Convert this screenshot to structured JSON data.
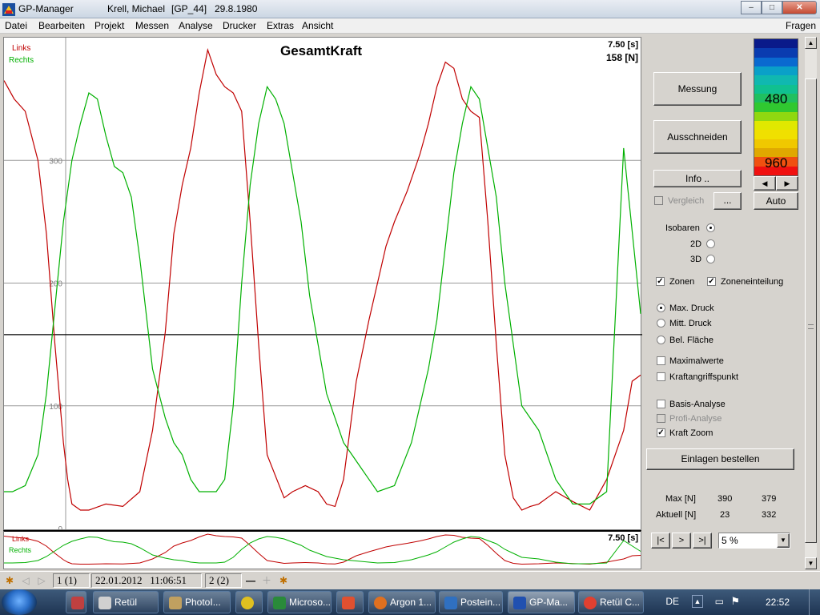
{
  "window": {
    "app_name": "GP-Manager",
    "patient_name": "Krell, Michael",
    "patient_code": "[GP_44]",
    "birth_date": "29.8.1980",
    "buttons": {
      "minimize": "–",
      "maximize": "□",
      "close": "✕"
    }
  },
  "menu": {
    "items": [
      "Datei",
      "Bearbeiten",
      "Projekt",
      "Messen",
      "Analyse",
      "Drucker",
      "Extras",
      "Ansicht"
    ],
    "help": "Fragen"
  },
  "chart": {
    "title": "GesamtKraft",
    "time_readout": "7.50 [s]",
    "force_readout": "158 [N]",
    "legend_links": "Links",
    "legend_rechts": "Rechts",
    "mini_time_readout": "7.50 [s]"
  },
  "chart_data": {
    "type": "line",
    "title": "GesamtKraft",
    "ylim": [
      0,
      400
    ],
    "yticks": [
      "300",
      "200",
      "100",
      "0"
    ],
    "cursor_value": 158,
    "xlim": [
      0,
      7.5
    ],
    "series": [
      {
        "name": "Links",
        "color": "#c00000",
        "x": [
          0,
          0.12,
          0.25,
          0.4,
          0.5,
          0.6,
          0.7,
          0.75,
          0.8,
          0.9,
          1.0,
          1.2,
          1.4,
          1.6,
          1.75,
          1.9,
          2.0,
          2.1,
          2.2,
          2.3,
          2.4,
          2.5,
          2.6,
          2.7,
          2.8,
          2.9,
          3.0,
          3.1,
          3.3,
          3.4,
          3.55,
          3.7,
          3.8,
          3.9,
          4.0,
          4.15,
          4.3,
          4.5,
          4.6,
          4.75,
          4.9,
          5.0,
          5.1,
          5.2,
          5.3,
          5.4,
          5.5,
          5.6,
          5.7,
          5.8,
          5.9,
          6.0,
          6.1,
          6.2,
          6.3,
          6.4,
          6.5,
          6.7,
          6.9,
          7.1,
          7.3,
          7.4,
          7.5
        ],
        "y": [
          365,
          350,
          340,
          300,
          240,
          150,
          70,
          40,
          20,
          15,
          15,
          20,
          18,
          30,
          80,
          160,
          240,
          280,
          310,
          355,
          390,
          370,
          360,
          355,
          340,
          250,
          150,
          60,
          25,
          30,
          35,
          30,
          20,
          18,
          40,
          120,
          170,
          230,
          250,
          275,
          305,
          330,
          360,
          380,
          375,
          350,
          340,
          335,
          250,
          150,
          60,
          25,
          15,
          18,
          20,
          25,
          30,
          22,
          15,
          40,
          80,
          120,
          125
        ]
      },
      {
        "name": "Rechts",
        "color": "#00b000",
        "x": [
          0,
          0.1,
          0.25,
          0.4,
          0.5,
          0.6,
          0.7,
          0.8,
          0.9,
          1.0,
          1.1,
          1.2,
          1.3,
          1.4,
          1.5,
          1.6,
          1.75,
          1.9,
          2.0,
          2.1,
          2.2,
          2.3,
          2.4,
          2.5,
          2.6,
          2.7,
          2.8,
          2.9,
          3.0,
          3.1,
          3.2,
          3.3,
          3.4,
          3.5,
          3.6,
          3.7,
          3.8,
          3.9,
          4.0,
          4.1,
          4.2,
          4.3,
          4.4,
          4.6,
          4.8,
          5.0,
          5.1,
          5.2,
          5.3,
          5.4,
          5.5,
          5.6,
          5.7,
          5.8,
          5.9,
          6.0,
          6.1,
          6.2,
          6.3,
          6.5,
          6.7,
          6.9,
          7.1,
          7.3,
          7.5
        ],
        "y": [
          30,
          30,
          35,
          60,
          110,
          180,
          250,
          300,
          330,
          355,
          350,
          320,
          295,
          290,
          270,
          220,
          130,
          90,
          70,
          60,
          40,
          30,
          30,
          30,
          40,
          100,
          200,
          280,
          330,
          360,
          350,
          330,
          290,
          250,
          190,
          150,
          110,
          90,
          70,
          60,
          50,
          40,
          30,
          35,
          70,
          130,
          170,
          230,
          290,
          330,
          360,
          350,
          310,
          270,
          200,
          150,
          100,
          90,
          80,
          40,
          20,
          20,
          30,
          310,
          175
        ]
      }
    ]
  },
  "panel": {
    "messung": "Messung",
    "ausschneiden": "Ausschneiden",
    "info": "Info ..",
    "vergleich": "Vergleich",
    "ellipsis": "...",
    "auto": "Auto",
    "scale_480": "480",
    "scale_960": "960",
    "scale_colors": [
      "#0a1a8a",
      "#0a3cb0",
      "#0a6ad0",
      "#0aa0c8",
      "#10b8b0",
      "#10c090",
      "#20c060",
      "#30c830",
      "#90d810",
      "#e0e800",
      "#f0e000",
      "#f0c800",
      "#e0a800",
      "#f05010",
      "#f01010"
    ],
    "isobaren": "Isobaren",
    "view_2d": "2D",
    "view_3d": "3D",
    "zonen": "Zonen",
    "zoneneinteilung": "Zoneneinteilung",
    "max_druck": "Max. Druck",
    "mitt_druck": "Mitt. Druck",
    "bel_flaeche": "Bel. Fläche",
    "maximalwerte": "Maximalwerte",
    "kraftangriffspunkt": "Kraftangriffspunkt",
    "basis_analyse": "Basis-Analyse",
    "profi_analyse": "Profi-Analyse",
    "kraft_zoom": "Kraft Zoom",
    "einlagen": "Einlagen bestellen",
    "max_label": "Max [N]",
    "max_left": "390",
    "max_right": "379",
    "aktuell_label": "Aktuell [N]",
    "aktuell_left": "23",
    "aktuell_right": "332",
    "nav_first": "|<",
    "nav_next": ">",
    "nav_last": ">|",
    "speed_value": "5 %"
  },
  "status": {
    "record": "1 (1)",
    "date": "22.01.2012",
    "time": "11:06:51",
    "step": "2 (2)"
  },
  "taskbar": {
    "items": [
      {
        "label": "Retül",
        "color": "#d0d0d0"
      },
      {
        "label": "PhotoI...",
        "color": "#c0a060"
      },
      {
        "label": "",
        "color": "#e0c020"
      },
      {
        "label": "Microso...",
        "color": "#2a8a3a"
      },
      {
        "label": "",
        "color": "#e05030"
      },
      {
        "label": "Argon 1...",
        "color": "#e07020"
      },
      {
        "label": "Postein...",
        "color": "#3070c0"
      },
      {
        "label": "GP-Ma...",
        "color": "#2050b0"
      },
      {
        "label": "Retül C...",
        "color": "#e04030"
      }
    ],
    "lang": "DE",
    "clock": "22:52"
  }
}
